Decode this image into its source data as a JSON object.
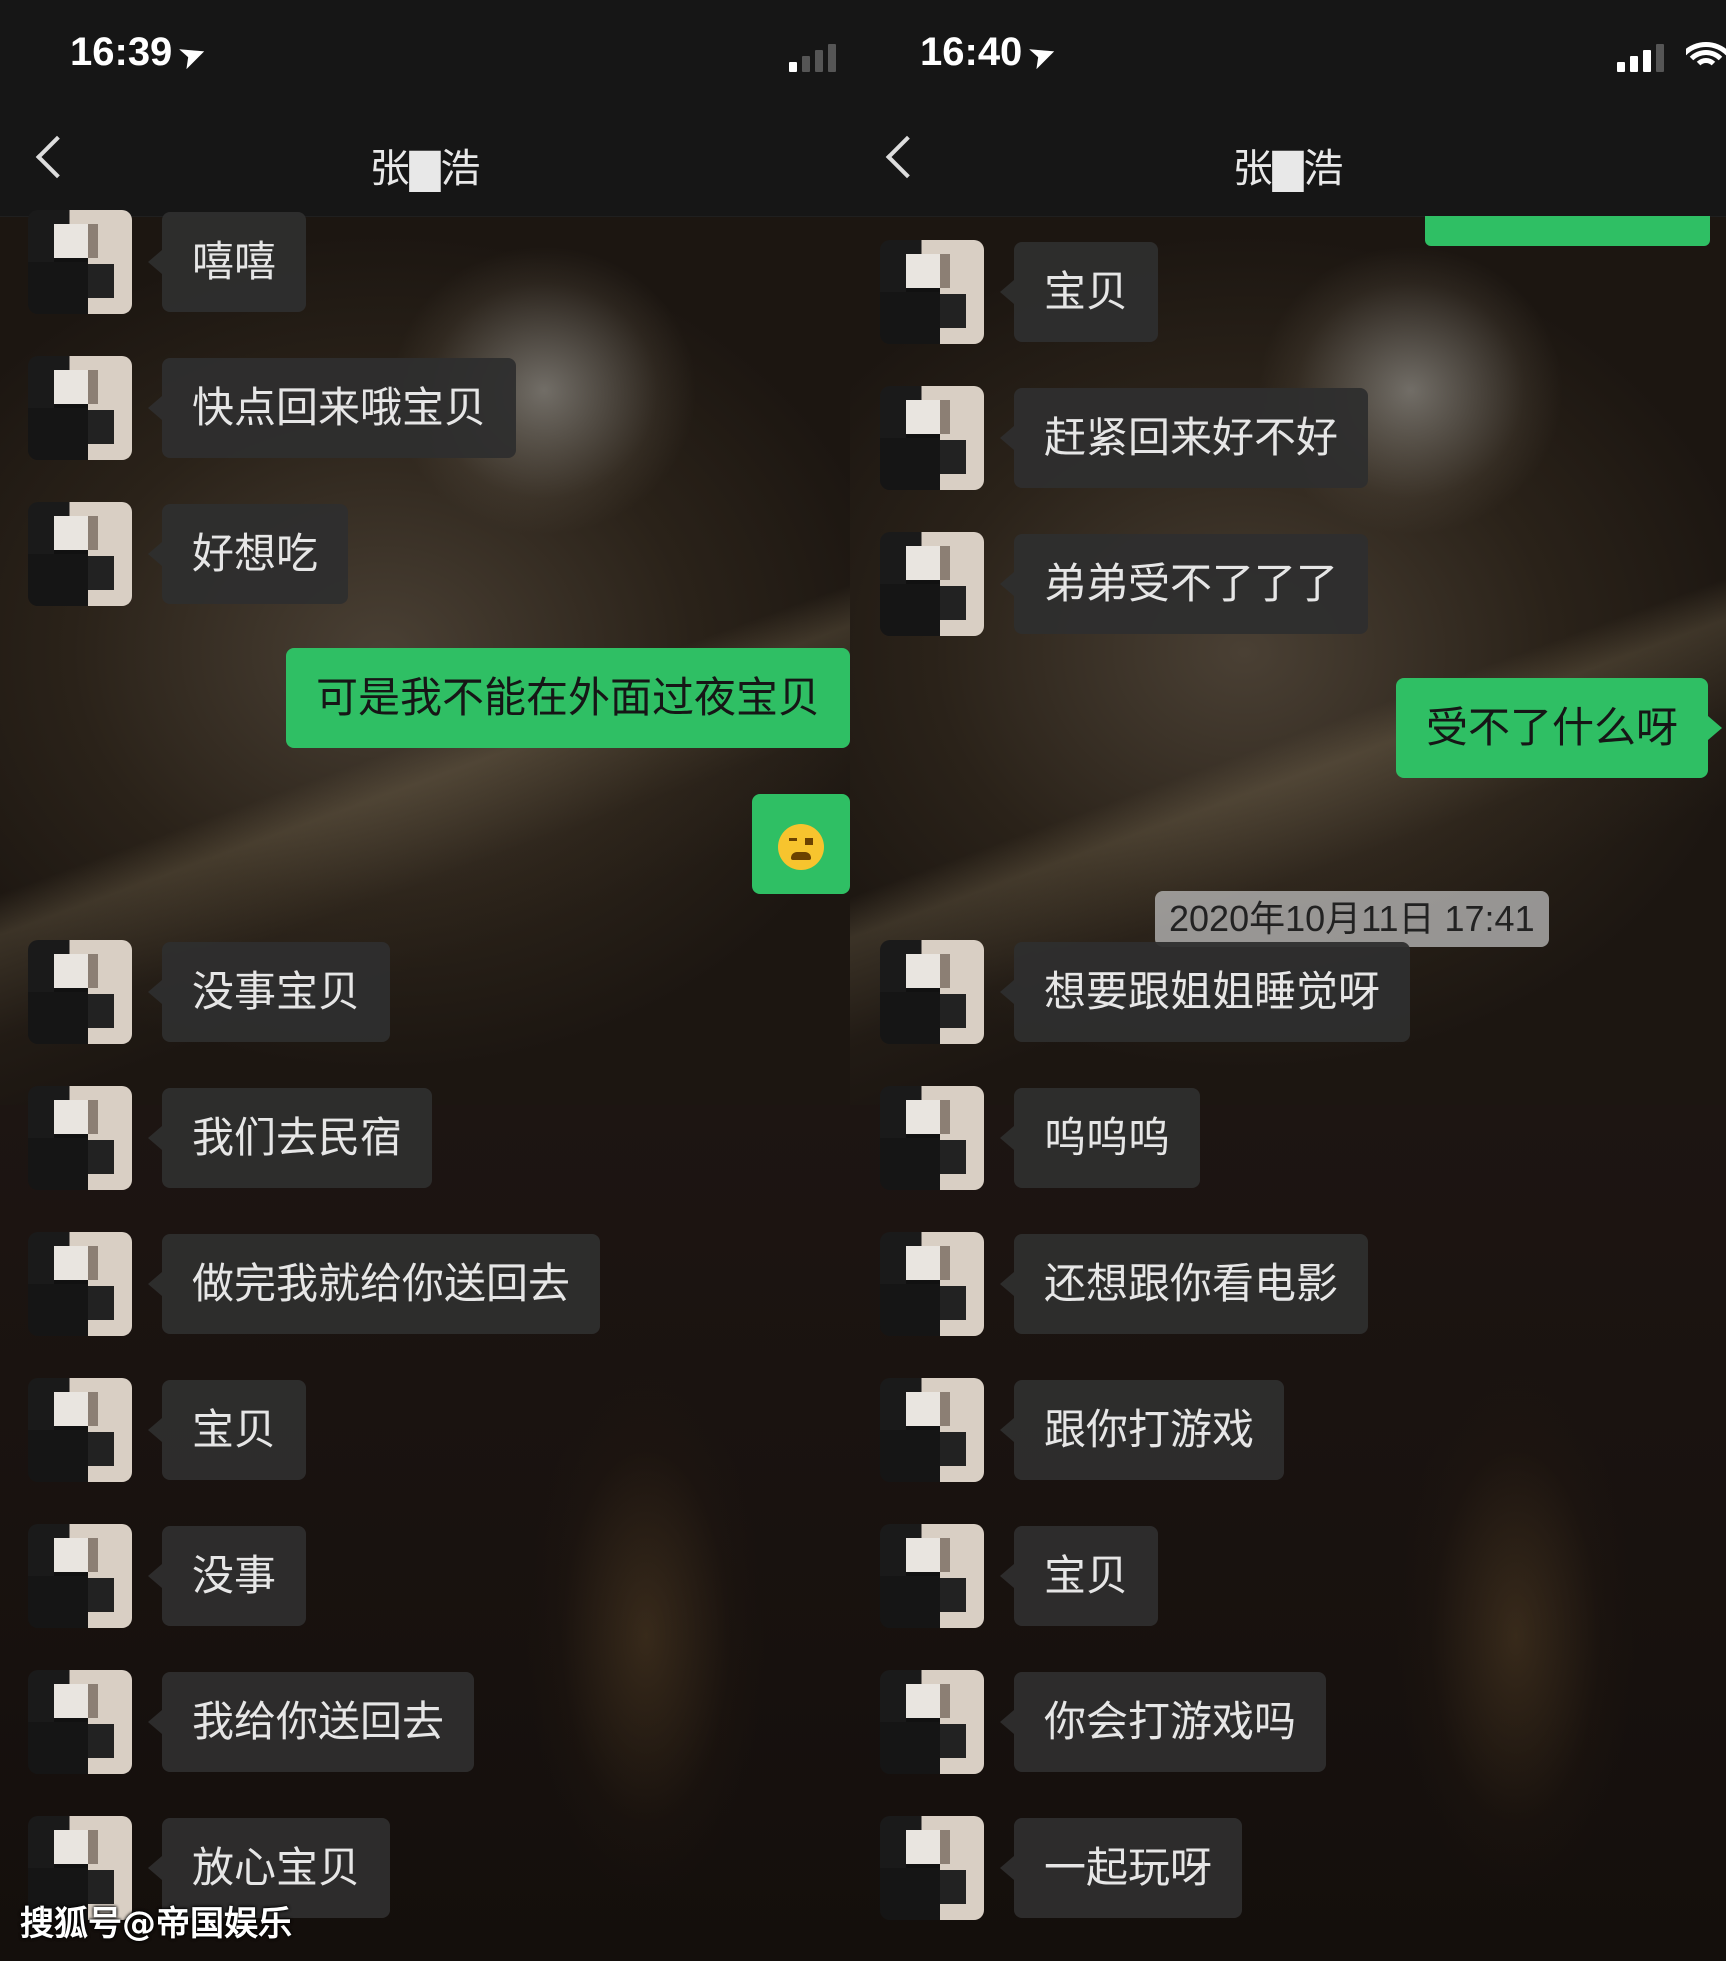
{
  "left": {
    "status_time": "16:39",
    "title": "张▇浩",
    "messages": [
      {
        "side": "in",
        "text": "嘻嘻"
      },
      {
        "side": "in",
        "text": "快点回来哦宝贝"
      },
      {
        "side": "in",
        "text": "好想吃"
      },
      {
        "side": "out",
        "text": "可是我不能在外面过夜宝贝"
      },
      {
        "side": "out",
        "text": "",
        "emoji": "crying-laugh-emoji"
      },
      {
        "side": "in",
        "text": "没事宝贝"
      },
      {
        "side": "in",
        "text": "我们去民宿"
      },
      {
        "side": "in",
        "text": "做完我就给你送回去"
      },
      {
        "side": "in",
        "text": "宝贝"
      },
      {
        "side": "in",
        "text": "没事"
      },
      {
        "side": "in",
        "text": "我给你送回去"
      },
      {
        "side": "in",
        "text": "放心宝贝"
      }
    ]
  },
  "right": {
    "status_time": "16:40",
    "title": "张▇浩",
    "timestamp": "2020年10月11日 17:41",
    "messages": [
      {
        "side": "in",
        "text": "宝贝"
      },
      {
        "side": "in",
        "text": "赶紧回来好不好"
      },
      {
        "side": "in",
        "text": "弟弟受不了了了"
      },
      {
        "side": "out",
        "text": "受不了什么呀"
      },
      {
        "side": "in",
        "text": "想要跟姐姐睡觉呀"
      },
      {
        "side": "in",
        "text": "呜呜呜"
      },
      {
        "side": "in",
        "text": "还想跟你看电影"
      },
      {
        "side": "in",
        "text": "跟你打游戏"
      },
      {
        "side": "in",
        "text": "宝贝"
      },
      {
        "side": "in",
        "text": "你会打游戏吗"
      },
      {
        "side": "in",
        "text": "一起玩呀"
      }
    ]
  },
  "watermark": "搜狐号@帝国娱乐",
  "icons": [
    "back-icon",
    "location-arrow-icon",
    "signal-icon",
    "wifi-icon"
  ],
  "colors": {
    "outgoing_bubble": "#2fbf64",
    "incoming_bubble": "#2e2e2e",
    "bar": "#161616"
  }
}
